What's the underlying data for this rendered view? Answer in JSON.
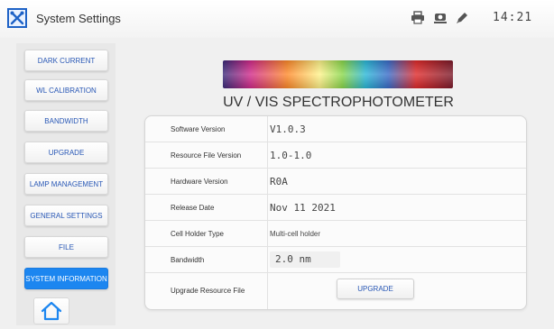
{
  "window": {
    "title": "System Settings",
    "clock": "14:21",
    "status_icons": [
      "printer-icon",
      "projector-icon",
      "pen-icon"
    ]
  },
  "sidebar": {
    "items": [
      {
        "label": "DARK CURRENT"
      },
      {
        "label": "WL CALIBRATION"
      },
      {
        "label": "BANDWIDTH"
      },
      {
        "label": "UPGRADE"
      },
      {
        "label": "LAMP MANAGEMENT"
      },
      {
        "label": "GENERAL SETTINGS"
      },
      {
        "label": "FILE"
      },
      {
        "label": "SYSTEM INFORMATION",
        "active": true
      }
    ],
    "home_icon": "home-icon"
  },
  "main": {
    "device_title": "UV / VIS  SPECTROPHOTOMETER",
    "info": {
      "software_version_label": "Software Version",
      "software_version_value": "V1.0.3",
      "resource_file_version_label": "Resource File Version",
      "resource_file_version_value": "1.0-1.0",
      "hardware_version_label": "Hardware Version",
      "hardware_version_value": "R0A",
      "release_date_label": "Release Date",
      "release_date_value": "Nov 11 2021",
      "cell_holder_type_label": "Cell Holder Type",
      "cell_holder_type_value": "Multi-cell holder",
      "bandwidth_label": "Bandwidth",
      "bandwidth_value": "2.0 nm",
      "upgrade_resource_file_label": "Upgrade Resource File",
      "upgrade_button_label": "UPGRADE"
    }
  },
  "colors": {
    "accent": "#1c86f0",
    "nav_text": "#2857b5",
    "background": "#f0f0f0"
  }
}
